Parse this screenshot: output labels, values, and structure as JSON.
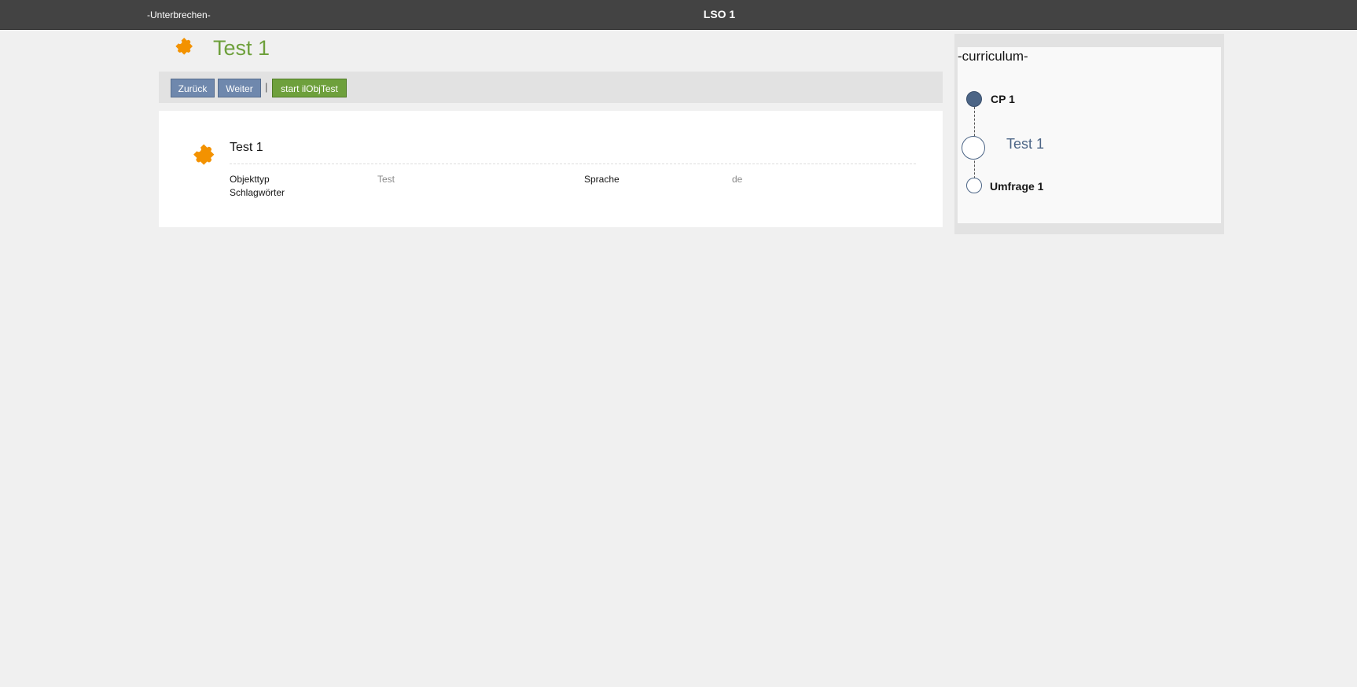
{
  "topbar": {
    "pause_label": "-Unterbrechen-",
    "title": "LSO 1"
  },
  "page": {
    "title": "Test 1",
    "icon": "puzzle-icon"
  },
  "toolbar": {
    "back_label": "Zurück",
    "next_label": "Weiter",
    "separator": "|",
    "start_label": "start ilObjTest"
  },
  "card": {
    "title": "Test 1",
    "icon": "puzzle-icon",
    "properties": [
      {
        "label": "Objekttyp",
        "value": "Test"
      },
      {
        "label": "Sprache",
        "value": "de"
      },
      {
        "label": "Schlagwörter",
        "value": ""
      }
    ]
  },
  "curriculum": {
    "title": "-curriculum-",
    "items": [
      {
        "label": "CP 1",
        "state": "completed"
      },
      {
        "label": "Test 1",
        "state": "current"
      },
      {
        "label": "Umfrage 1",
        "state": "open"
      }
    ]
  },
  "colors": {
    "topbar": "#434343",
    "accent_green": "#6ea03c",
    "button_blue": "#6f88ad",
    "icon_orange": "#f39200",
    "node_blue": "#4c6586"
  }
}
